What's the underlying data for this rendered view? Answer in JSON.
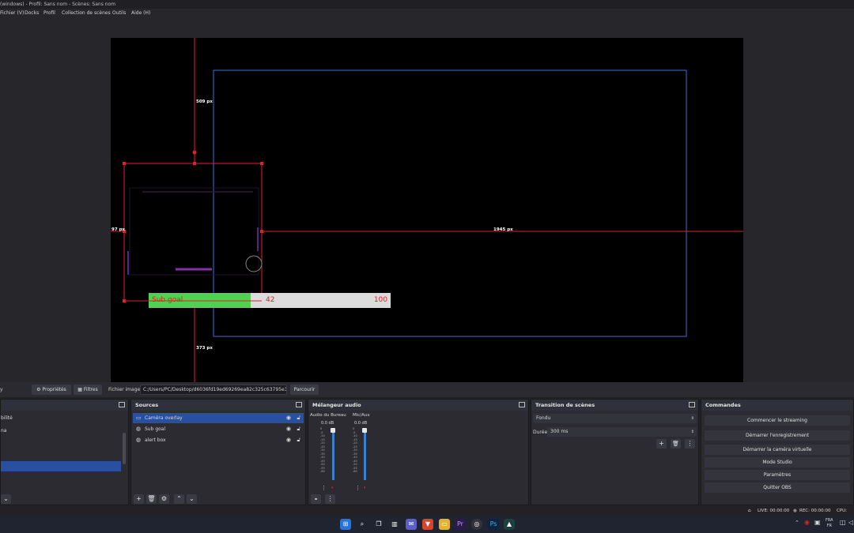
{
  "window": {
    "title": "(windows) - Profil: Sans nom - Scènes: Sans nom"
  },
  "menu": [
    "Fichier (V)",
    "Docks",
    "Profil",
    "Collection de scènes",
    "Outils",
    "Aide (H)"
  ],
  "preview": {
    "measure_top": "509 px",
    "measure_left": "97 px",
    "measure_right": "1945 px",
    "measure_bottom": "373 px",
    "subgoal_label": "Sub goal",
    "subgoal_current": "42",
    "subgoal_max": "100",
    "subgoal_progress": 0.42,
    "colors": {
      "selection": "#e0202a",
      "bounds": "#3a6fd8",
      "goal_fill": "#4fd24f",
      "goal_bg": "#dcdcdc",
      "goal_text": "#e02020"
    }
  },
  "properties_bar": {
    "properties_label": "Propriétés",
    "filters_label": "Filtres",
    "file_label": "Fichier image",
    "file_path": "C:/Users/PC/Desktop/d6036fd19ed69269ea82c325c63795e3.png",
    "browse_label": "Parcourir"
  },
  "scenes": {
    "items": [
      "bilité",
      "na"
    ]
  },
  "sources": {
    "title": "Sources",
    "items": [
      {
        "label": "Caméra overlay",
        "icon": "monitor-icon",
        "selected": true
      },
      {
        "label": "Sub goal",
        "icon": "browser-icon",
        "selected": false
      },
      {
        "label": "alert box",
        "icon": "browser-icon",
        "selected": false
      }
    ]
  },
  "mixer": {
    "title": "Mélangeur audio",
    "channels": [
      {
        "name": "Audio du Bureau",
        "db": "0.0 dB"
      },
      {
        "name": "Mic/Aux",
        "db": "0.0 dB"
      }
    ],
    "scale": [
      "0",
      "-5",
      "-10",
      "-15",
      "-20",
      "-25",
      "-30",
      "-35",
      "-40",
      "-45",
      "-50",
      "-55",
      "-60"
    ]
  },
  "transitions": {
    "title": "Transition de scènes",
    "selected": "Fondu",
    "duration_label": "Durée",
    "duration_value": "300 ms"
  },
  "commands": {
    "title": "Commandes",
    "buttons": [
      "Commencer le streaming",
      "Démarrer l'enregistrement",
      "Démarrer la caméra virtuelle",
      "Mode Studio",
      "Paramètres",
      "Quitter OBS"
    ]
  },
  "status": {
    "live": "LIVE: 00:00:00",
    "rec": "REC: 00:00:00",
    "cpu": "CPU: 1.1"
  },
  "taskbar": {
    "lang_top": "FRA",
    "lang_bottom": "FR"
  }
}
